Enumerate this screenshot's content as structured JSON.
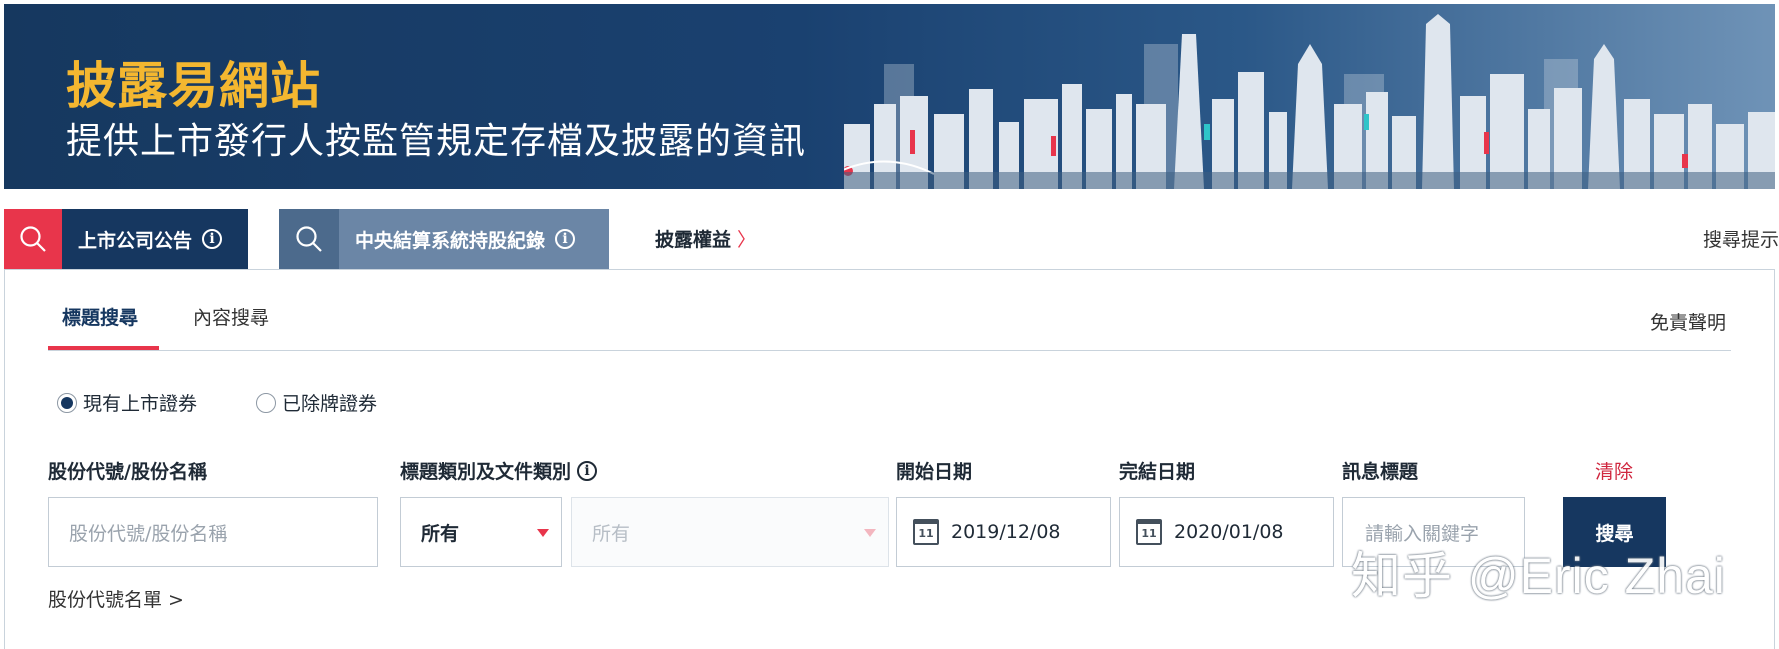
{
  "banner": {
    "title": "披露易網站",
    "subtitle": "提供上市發行人按監管規定存檔及披露的資訊"
  },
  "tabs": {
    "listed_announcements": "上市公司公告",
    "ccass": "中央結算系統持股紀錄",
    "disclosure_of_interests": "披露權益",
    "disclosure_chevron": "〉",
    "search_tips": "搜尋提示"
  },
  "subtabs": {
    "title_search": "標題搜尋",
    "content_search": "內容搜尋",
    "disclaimer": "免責聲明"
  },
  "radios": {
    "current": "現有上市證券",
    "delisted": "已除牌證券",
    "selected": "current"
  },
  "labels": {
    "stock": "股份代號/股份名稱",
    "category": "標題類別及文件類別",
    "start_date": "開始日期",
    "end_date": "完結日期",
    "headline": "訊息標題",
    "clear": "清除"
  },
  "inputs": {
    "stock_placeholder": "股份代號/股份名稱",
    "category_value": "所有",
    "doc_type_value": "所有",
    "start_date": "2019/12/08",
    "end_date": "2020/01/08",
    "keyword_placeholder": "請輸入關鍵字",
    "calendar_day": "11"
  },
  "buttons": {
    "search": "搜尋"
  },
  "links": {
    "stock_list": "股份代號名單 >"
  },
  "watermark": "知乎 @Eric Zhai",
  "icons": {
    "tab_search": "search-icon",
    "info": "info-icon",
    "calendar": "calendar-icon"
  },
  "colors": {
    "navy": "#163760",
    "accent_red": "#e8354b",
    "banner_gold": "#f4b730",
    "slate": "#6b86a6"
  }
}
